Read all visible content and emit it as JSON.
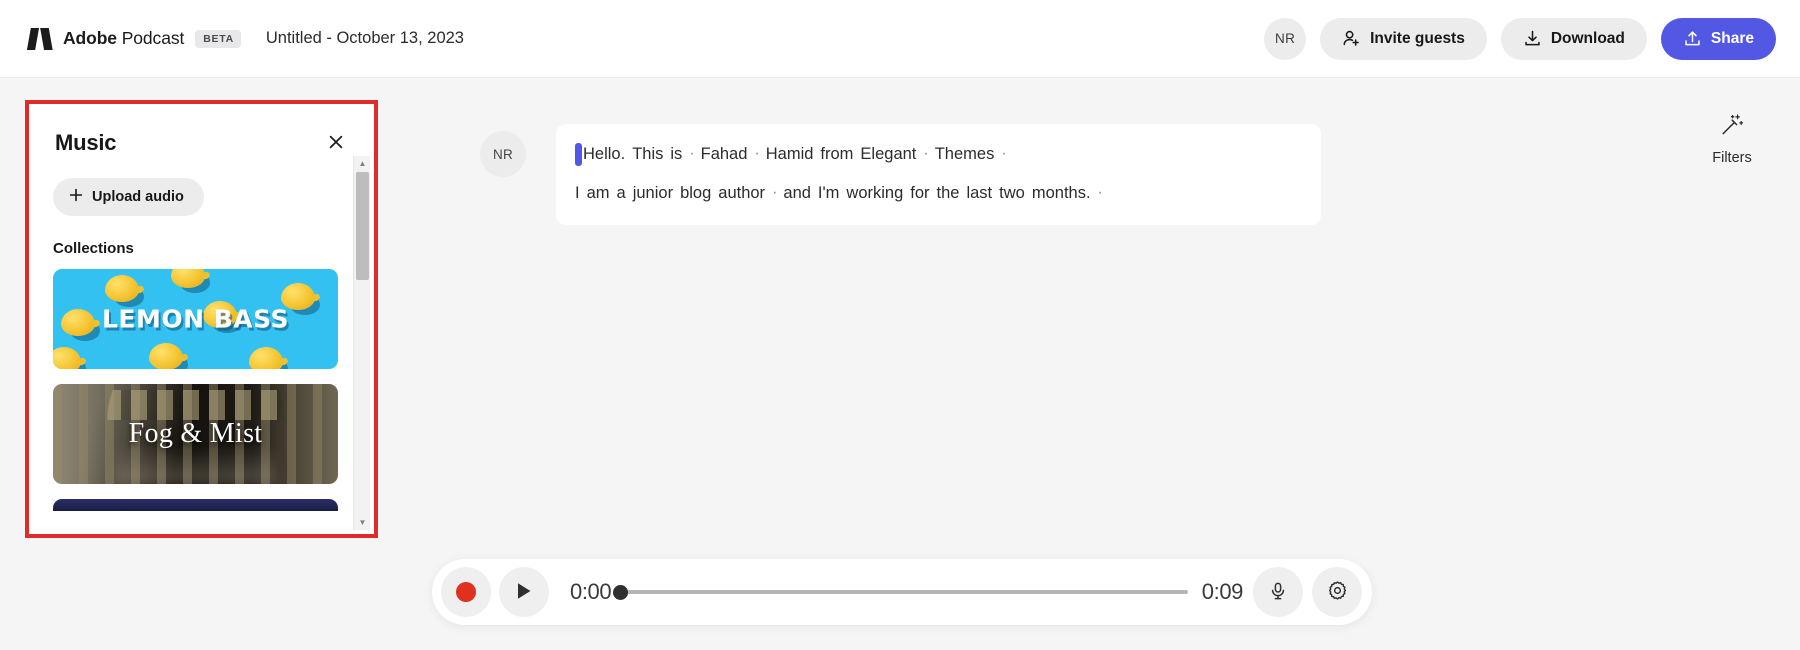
{
  "header": {
    "brand_bold": "Adobe",
    "brand_light": " Podcast",
    "beta": "BETA",
    "doc_title": "Untitled - October 13, 2023",
    "avatar_initials": "NR",
    "invite_label": "Invite guests",
    "download_label": "Download",
    "share_label": "Share",
    "accent_color": "#5258e4"
  },
  "music_panel": {
    "title": "Music",
    "close_icon": "close-icon",
    "upload_label": "Upload audio",
    "collections_label": "Collections",
    "items": [
      {
        "name": "LEMON BASS",
        "art": "lemon"
      },
      {
        "name": "Fog & Mist",
        "art": "fog"
      },
      {
        "name": "",
        "art": "navy"
      }
    ],
    "highlight_border_color": "#e02b2b"
  },
  "transcript": {
    "speaker_initials": "NR",
    "lines": [
      {
        "caret": true,
        "tokens": [
          {
            "t": "Hello.",
            "sep": false
          },
          {
            "t": "This",
            "sep": false
          },
          {
            "t": "is",
            "sep": true
          },
          {
            "t": "Fahad",
            "sep": true
          },
          {
            "t": "Hamid",
            "sep": false
          },
          {
            "t": "from",
            "sep": false
          },
          {
            "t": "Elegant",
            "sep": true
          },
          {
            "t": "Themes",
            "sep": true
          }
        ]
      },
      {
        "caret": false,
        "tokens": [
          {
            "t": "I",
            "sep": false
          },
          {
            "t": "am",
            "sep": false
          },
          {
            "t": "a",
            "sep": false
          },
          {
            "t": "junior",
            "sep": false
          },
          {
            "t": "blog",
            "sep": false
          },
          {
            "t": "author",
            "sep": true
          },
          {
            "t": "and",
            "sep": false
          },
          {
            "t": "I'm",
            "sep": false
          },
          {
            "t": "working",
            "sep": false
          },
          {
            "t": "for",
            "sep": false
          },
          {
            "t": "the",
            "sep": false
          },
          {
            "t": "last",
            "sep": false
          },
          {
            "t": "two",
            "sep": false
          },
          {
            "t": "months.",
            "sep": true
          }
        ]
      }
    ],
    "caret_color": "#5258e4"
  },
  "filters": {
    "label": "Filters",
    "icon": "magic-wand-icon"
  },
  "playback": {
    "record_icon": "record-icon",
    "play_icon": "play-icon",
    "current_time": "0:00",
    "total_time": "0:09",
    "progress_percent": 0,
    "mic_icon": "microphone-icon",
    "settings_icon": "gear-icon",
    "record_color": "#e0301e"
  }
}
